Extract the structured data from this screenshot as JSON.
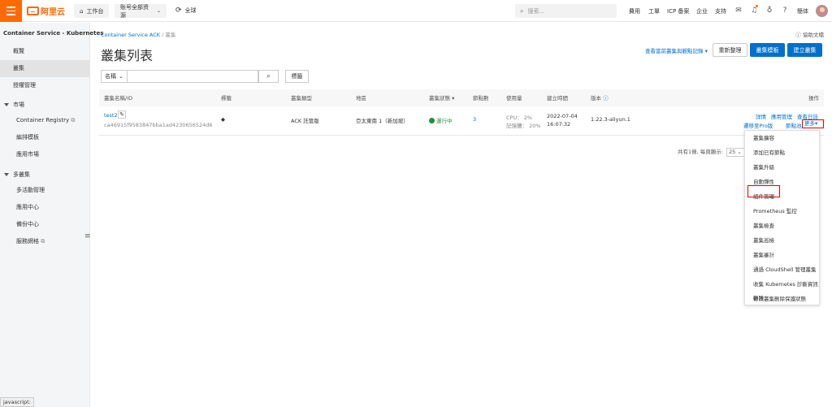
{
  "topbar": {
    "logo_text": "阿里云",
    "workbench": "工作台",
    "resources": "账号全部资源",
    "region": "全球",
    "search_placeholder": "搜索...",
    "nav": [
      "費用",
      "工單",
      "ICP 备案",
      "企业",
      "支持"
    ],
    "lang": "簡体",
    "brand_color": "#ff6a00"
  },
  "sidebar": {
    "title": "Container Service - Kubernetes",
    "items": {
      "overview": "概覽",
      "clusters": "叢集",
      "auth": "授權管理",
      "market": "市場",
      "registry": "Container Registry",
      "templates": "編排模板",
      "app_market": "應用市場",
      "multi": "多叢集",
      "multi_active": "多活動管理",
      "app_center": "應用中心",
      "backup": "備份中心",
      "service_mesh": "服務網格"
    },
    "status": "javascript:"
  },
  "main": {
    "breadcrumb": [
      "Container Service ACK",
      "叢集"
    ],
    "help": "協助文檔",
    "title": "叢集列表",
    "logs_link": "查看當前叢集與觀點記錄",
    "buttons": {
      "refresh": "重新整理",
      "template": "叢集模板",
      "create": "建立叢集"
    },
    "filter": {
      "select": "名稱",
      "tag": "標籤"
    },
    "table": {
      "headers": [
        "叢集名稱/ID",
        "標籤",
        "叢集類型",
        "地區",
        "叢集狀態",
        "節點數",
        "使用量",
        "建立時間",
        "版本",
        "操作"
      ],
      "row": {
        "name": "test2",
        "id": "ca46915f9583847bba1ad4230656524d6",
        "type": "ACK 託管版",
        "region": "亞太東南 1（新加坡）",
        "status": "運行中",
        "nodes": "3",
        "cpu": "CPU：  2%",
        "mem": "記憶體：  20%",
        "created_date": "2022-07-04",
        "created_time": "16:07:32",
        "version": "1.22.3-aliyun.1",
        "ops": {
          "detail": "詳情",
          "app_mgmt": "應用管理",
          "logs": "查看日誌",
          "migrate": "遷移至Pro版",
          "node_pool": "節點池",
          "more": "更多"
        }
      }
    },
    "pagination": {
      "text": "共有1條, 每頁顯示:",
      "per_page": "25"
    }
  },
  "dropdown": {
    "items": [
      "叢集擴容",
      "添加已有節點",
      "叢集升級",
      "自動彈性",
      "組件管理",
      "Prometheus 監控",
      "叢集檢查",
      "叢集巡檢",
      "叢集審計",
      "通過 CloudShell 管理叢集",
      "收集 Kubernetes 診斷資訊",
      "修改叢集刪除保護狀態",
      "刪除"
    ]
  }
}
